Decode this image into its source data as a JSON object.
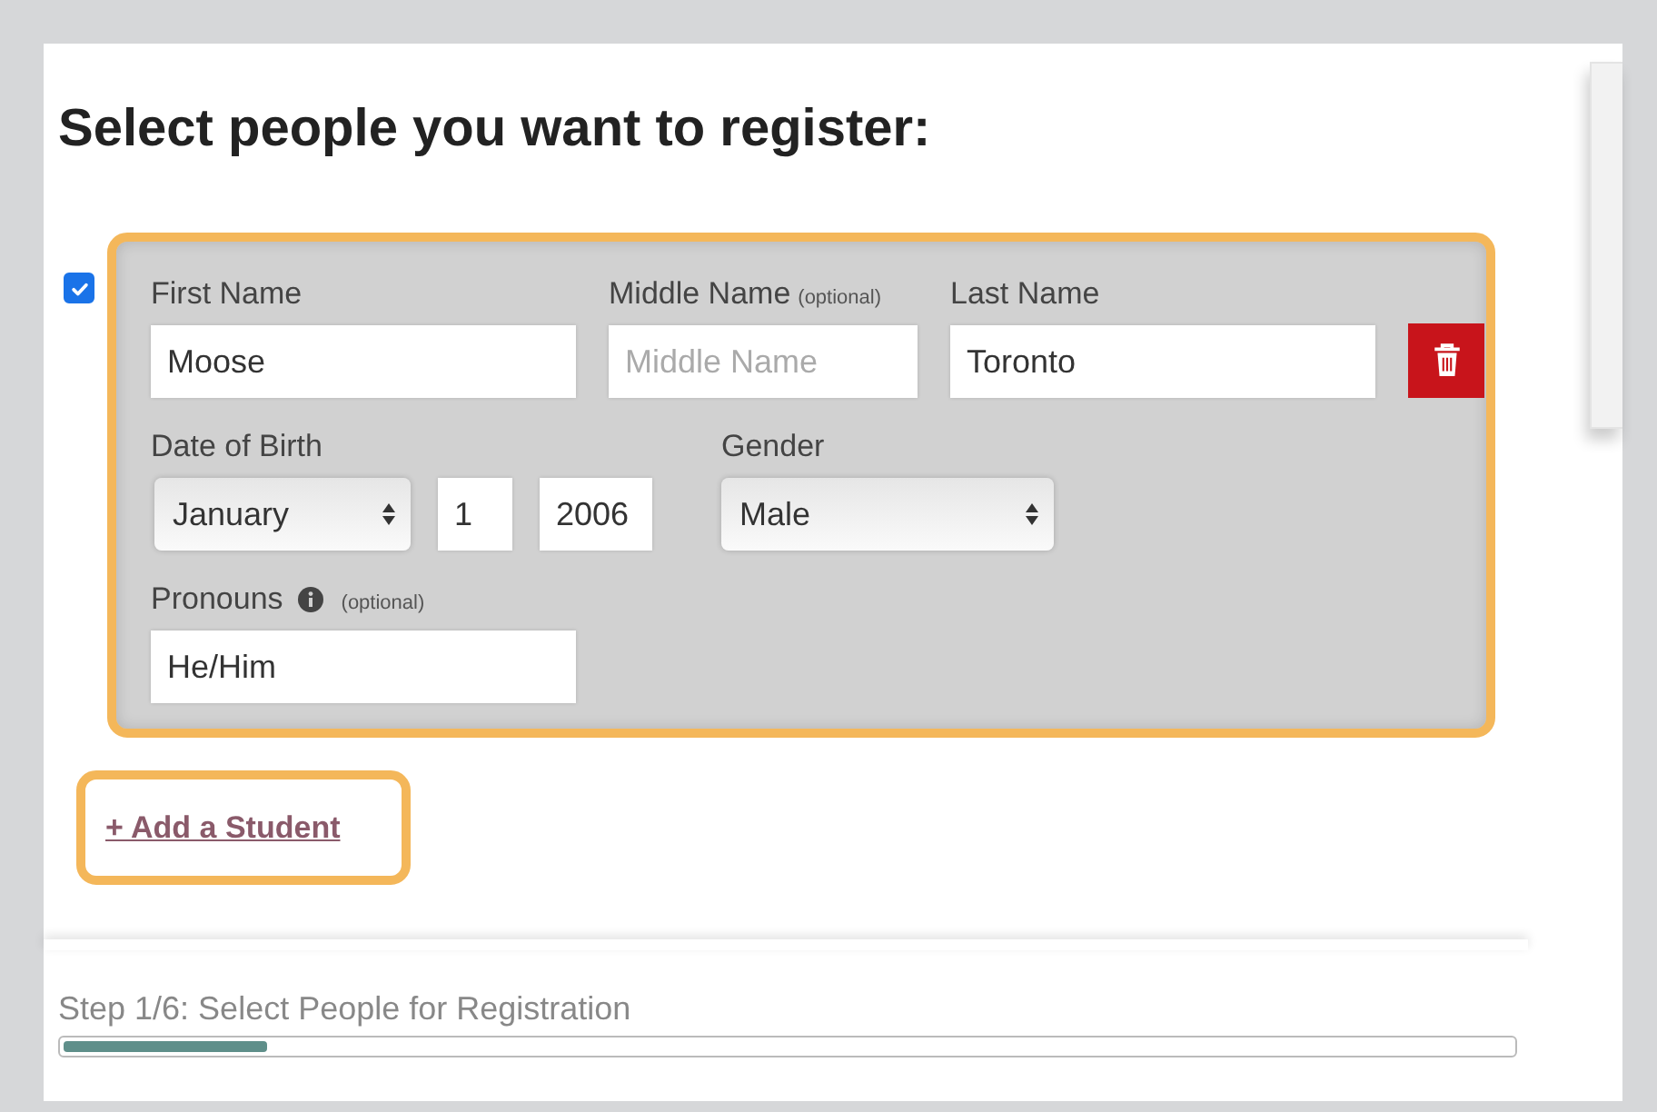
{
  "heading": "Select people you want to register:",
  "students": [
    {
      "checked": true,
      "first_name": {
        "label": "First Name",
        "value": "Moose"
      },
      "middle_name": {
        "label": "Middle Name",
        "note": "(optional)",
        "placeholder": "Middle Name"
      },
      "last_name": {
        "label": "Last Name",
        "value": "Toronto"
      },
      "date_of_birth": {
        "label": "Date of Birth",
        "month": "January",
        "day": "1",
        "year": "2006"
      },
      "gender": {
        "label": "Gender",
        "value": "Male"
      },
      "pronouns": {
        "label": "Pronouns",
        "note": "(optional)",
        "value": "He/Him"
      }
    }
  ],
  "add_student": "+ Add a Student",
  "progress": {
    "step": "Step 1/6: Select People for Registration",
    "level": 0.14
  }
}
